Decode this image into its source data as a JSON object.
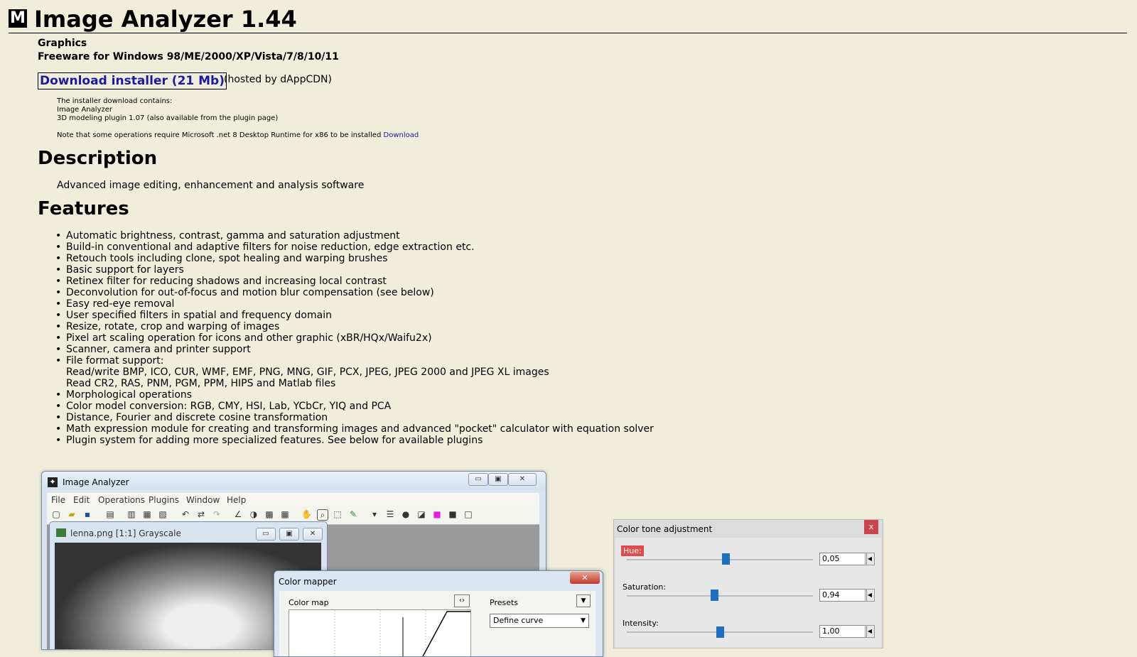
{
  "header": {
    "logo_text": "M",
    "title": "Image Analyzer 1.44",
    "category": "Graphics",
    "platform": "Freeware for Windows 98/ME/2000/XP/Vista/7/8/10/11"
  },
  "download": {
    "button_label": "Download installer (21 Mb)",
    "hosted_note": "(hosted by dAppCDN)",
    "contains_label": "The installer download contains:",
    "items": [
      "Image Analyzer",
      "3D modeling plugin 1.07 (also available from the plugin page)"
    ],
    "runtime_note": "Note that some operations require Microsoft .net 8 Desktop Runtime for x86 to be installed",
    "runtime_link": "Download"
  },
  "description": {
    "heading": "Description",
    "text": "Advanced image editing, enhancement and analysis software"
  },
  "features": {
    "heading": "Features",
    "items": [
      "Automatic brightness, contrast, gamma and saturation adjustment",
      "Build-in conventional and adaptive filters for noise reduction, edge extraction etc.",
      "Retouch tools including clone, spot healing and warping brushes",
      "Basic support for layers",
      "Retinex filter for reducing shadows and increasing local contrast",
      "Deconvolution for out-of-focus and motion blur compensation (see below)",
      "Easy red-eye removal",
      "User specified filters in spatial and frequency domain",
      "Resize, rotate, crop and warping of images",
      "Pixel art scaling operation for icons and other graphic (xBR/HQx/Waifu2x)",
      "Scanner, camera and printer support",
      "File format support:",
      "Read/write BMP, ICO, CUR, WMF, EMF, PNG, MNG, GIF, PCX, JPEG, JPEG 2000 and JPEG XL images",
      "Read CR2, RAS, PNM, PGM, PPM, HIPS and Matlab files",
      "Morphological operations",
      "Color model conversion: RGB, CMY, HSI, Lab, YCbCr, YIQ and PCA",
      "Distance, Fourier and discrete cosine transformation",
      "Math expression module for creating and transforming images and advanced \"pocket\" calculator with equation solver",
      "Plugin system for adding more specialized features. See below for available plugins"
    ]
  },
  "screenshot": {
    "main_window_title": "Image Analyzer",
    "menu": [
      "File",
      "Edit",
      "Operations",
      "Plugins",
      "Window",
      "Help"
    ],
    "child_window_title": "lenna.png [1:1] Grayscale",
    "color_mapper": {
      "title": "Color mapper",
      "color_map_label": "Color map",
      "presets_label": "Presets",
      "preset_value": "Define curve"
    },
    "color_tone": {
      "title": "Color tone adjustment",
      "hue_label": "Hue:",
      "hue_value": "0,05",
      "hue_level": 0.53,
      "saturation_label": "Saturation:",
      "saturation_value": "0,94",
      "saturation_level": 0.47,
      "intensity_label": "Intensity:",
      "intensity_value": "1,00",
      "intensity_level": 0.5
    }
  }
}
